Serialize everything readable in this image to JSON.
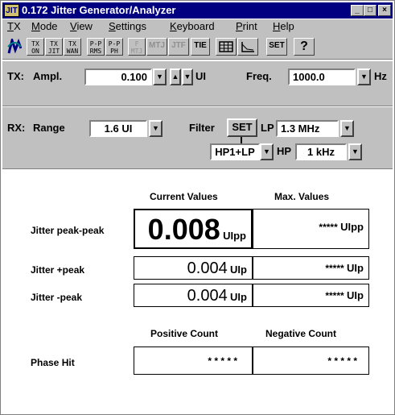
{
  "window": {
    "app_icon": "JIT",
    "title": "0.172 Jitter Generator/Analyzer"
  },
  "menu": [
    "TX",
    "Mode",
    "View",
    "Settings",
    "Keyboard",
    "Print",
    "Help"
  ],
  "toolbar": {
    "tools": [
      {
        "name": "tx-on",
        "top": "TX",
        "bottom": "ON",
        "enabled": true
      },
      {
        "name": "tx-jit",
        "top": "TX",
        "bottom": "JIT",
        "enabled": true
      },
      {
        "name": "tx-wan",
        "top": "TX",
        "bottom": "WAN",
        "enabled": true
      },
      {
        "name": "pp-rms",
        "top": "P-P",
        "bottom": "RMS",
        "enabled": true
      },
      {
        "name": "pp-ph",
        "top": "P-P",
        "bottom": "PH",
        "enabled": true
      },
      {
        "name": "f-mtj",
        "top": "F",
        "bottom": "MTJ",
        "enabled": false
      },
      {
        "name": "mtj",
        "label": "MTJ",
        "enabled": false
      },
      {
        "name": "jtf",
        "label": "JTF",
        "enabled": false
      },
      {
        "name": "tie",
        "label": "TIE",
        "enabled": true
      },
      {
        "name": "table-view",
        "icon": "table-icon",
        "enabled": true
      },
      {
        "name": "graph-view",
        "icon": "graph-icon",
        "enabled": true
      },
      {
        "name": "set",
        "label": "SET",
        "enabled": true
      },
      {
        "name": "help",
        "label": "?",
        "enabled": true
      }
    ]
  },
  "tx": {
    "label": "TX:",
    "ampl_label": "Ampl.",
    "ampl_value": "0.100",
    "ampl_unit": "UI",
    "freq_label": "Freq.",
    "freq_value": "1000.0",
    "freq_unit": "Hz"
  },
  "rx": {
    "label": "RX:",
    "range_label": "Range",
    "range_value": "1.6 UI",
    "filter_label": "Filter",
    "set_label": "SET",
    "lp_label": "LP",
    "lp_value": "1.3 MHz",
    "filter_value": "HP1+LP",
    "hp_label": "HP",
    "hp_value": "1 kHz"
  },
  "results": {
    "col_current": "Current Values",
    "col_max": "Max. Values",
    "rows": [
      {
        "label": "Jitter  peak-peak",
        "current": "0.008",
        "current_unit": "UIpp",
        "max": "*****",
        "max_unit": "UIpp"
      },
      {
        "label": "Jitter  +peak",
        "current": "0.004",
        "current_unit": "UIp",
        "max": "*****",
        "max_unit": "UIp"
      },
      {
        "label": "Jitter  -peak",
        "current": "0.004",
        "current_unit": "UIp",
        "max": "*****",
        "max_unit": "UIp"
      }
    ],
    "col_pos": "Positive Count",
    "col_neg": "Negative Count",
    "phase_hit_label": "Phase Hit",
    "phase_hit_pos": "* * * * *",
    "phase_hit_neg": "* * * * *"
  },
  "colors": {
    "titlebar": "#000080",
    "chrome": "#c0c0c0",
    "panel": "#ffffff"
  }
}
